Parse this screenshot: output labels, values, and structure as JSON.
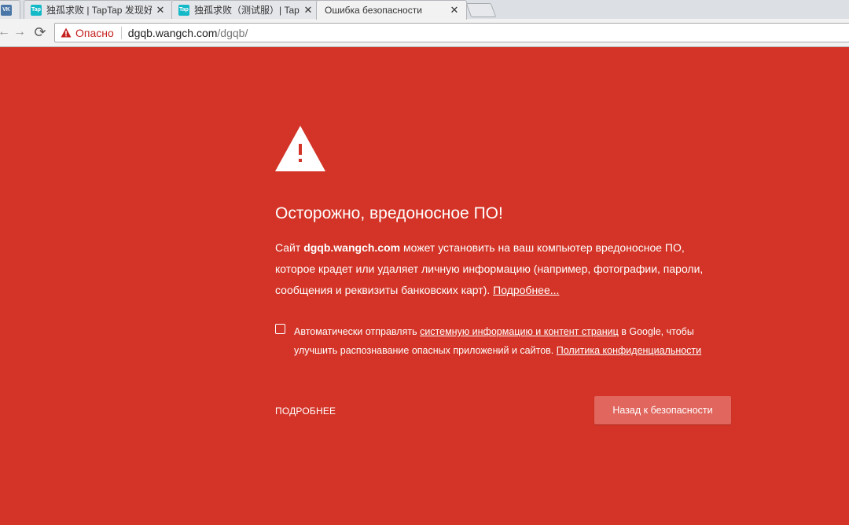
{
  "browser": {
    "tabs": [
      {
        "title": "",
        "favicon": "vk-logo",
        "favicon_text": "VK"
      },
      {
        "title": "独孤求败 | TapTap 发现好",
        "favicon": "taptap-logo",
        "favicon_text": "Tap",
        "close": "✕"
      },
      {
        "title": "独孤求败（测试服）| Tap",
        "favicon": "taptap-logo",
        "favicon_text": "Tap",
        "close": "✕"
      },
      {
        "title": "Ошибка безопасности",
        "close": "✕"
      }
    ],
    "toolbar": {
      "back_icon": "←",
      "forward_icon": "→",
      "reload_icon": "⟳"
    },
    "omnibox": {
      "security_label": "Опасно",
      "url_host": "dgqb.wangch.com",
      "url_path": "/dgqb/"
    }
  },
  "interstitial": {
    "heading": "Осторожно, вредоносное ПО!",
    "para_line1_prefix": "Сайт ",
    "para_site": "dgqb.wangch.com",
    "para_line1_suffix": " может установить на ваш компьютер вредоносное ПО,",
    "para_line2": "которое крадет или удаляет личную информацию (например, фотографии, пароли,",
    "para_line3": "сообщения и реквизиты банковских карт). ",
    "para_link": "Подробнее...",
    "optin_prefix": "Автоматически отправлять ",
    "optin_link1": "системную информацию и контент страниц",
    "optin_middle": " в Google, чтобы",
    "optin_line2": "улучшить распознавание опасных приложений и сайтов. ",
    "optin_link2": "Политика конфиденциальности",
    "optin_checked": false,
    "details_button": "ПОДРОБНЕЕ",
    "back_button": "Назад к безопасности"
  },
  "colors": {
    "background": "#d33427",
    "primary_button": "#e0665e",
    "danger_text": "#c5221f"
  }
}
